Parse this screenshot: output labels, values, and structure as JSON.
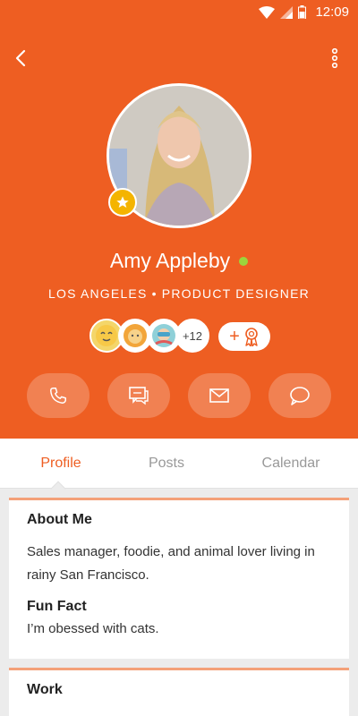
{
  "statusbar": {
    "time": "12:09"
  },
  "profile": {
    "name": "Amy Appleby",
    "subtitle": "LOS ANGELES • PRODUCT DESIGNER",
    "online": true,
    "badges_more": "+12",
    "award_plus": "+"
  },
  "colors": {
    "accent": "#ee5e22",
    "online": "#9bd53c",
    "star": "#f4b400"
  },
  "actions": [
    {
      "icon": "phone-icon"
    },
    {
      "icon": "chat-icon"
    },
    {
      "icon": "mail-icon"
    },
    {
      "icon": "comment-icon"
    }
  ],
  "tabs": [
    {
      "label": "Profile",
      "active": true
    },
    {
      "label": "Posts",
      "active": false
    },
    {
      "label": "Calendar",
      "active": false
    }
  ],
  "about": {
    "title": "About Me",
    "text": "Sales manager, foodie, and animal lover living in rainy San Francisco.",
    "fun_fact_title": "Fun Fact",
    "fun_fact_text": "I’m obessed with cats."
  },
  "work": {
    "title": "Work"
  }
}
